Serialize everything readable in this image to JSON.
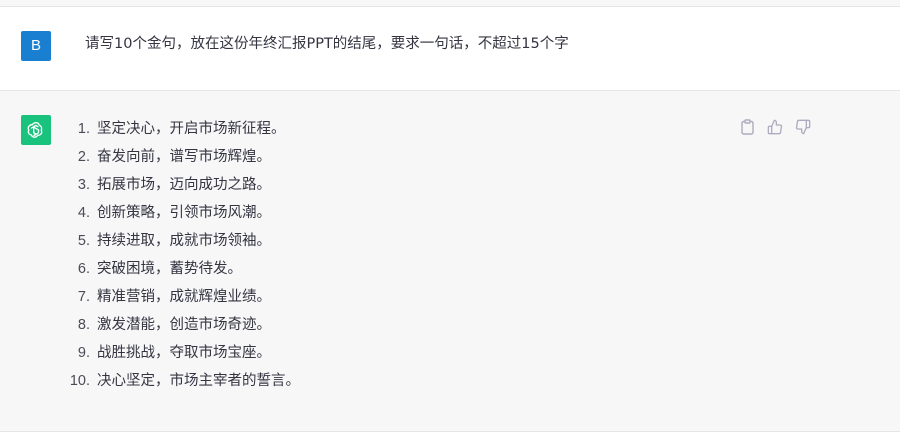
{
  "user_message": {
    "avatar_letter": "B",
    "text": "请写10个金句，放在这份年终汇报PPT的结尾，要求一句话，不超过15个字"
  },
  "assistant_message": {
    "items": [
      {
        "num": "1.",
        "text": "坚定决心，开启市场新征程。"
      },
      {
        "num": "2.",
        "text": "奋发向前，谱写市场辉煌。"
      },
      {
        "num": "3.",
        "text": "拓展市场，迈向成功之路。"
      },
      {
        "num": "4.",
        "text": "创新策略，引领市场风潮。"
      },
      {
        "num": "5.",
        "text": "持续进取，成就市场领袖。"
      },
      {
        "num": "6.",
        "text": "突破困境，蓄势待发。"
      },
      {
        "num": "7.",
        "text": "精准营销，成就辉煌业绩。"
      },
      {
        "num": "8.",
        "text": "激发潜能，创造市场奇迹。"
      },
      {
        "num": "9.",
        "text": "战胜挑战，夺取市场宝座。"
      },
      {
        "num": "10.",
        "text": "决心坚定，市场主宰者的誓言。"
      }
    ],
    "actions": [
      "clipboard-icon",
      "thumbs-up-icon",
      "thumbs-down-icon"
    ]
  },
  "colors": {
    "user_avatar": "#1a7fd0",
    "bot_avatar": "#19c37d",
    "assistant_bg": "#f7f7f8"
  }
}
